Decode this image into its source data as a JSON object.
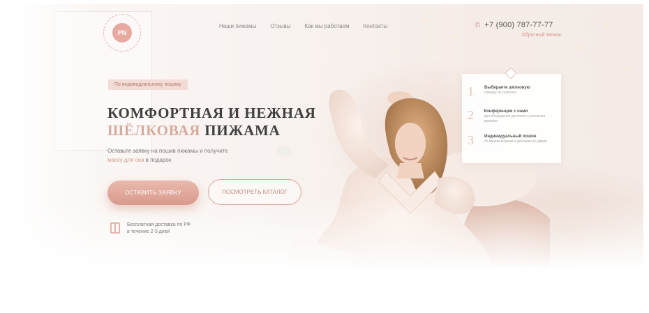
{
  "logo": {
    "mark": "PN"
  },
  "nav": {
    "items": [
      "Наши пижамы",
      "Отзывы",
      "Как мы работаем",
      "Контакты"
    ]
  },
  "header": {
    "phone": "+7 (900) 787-77-77",
    "callback_label": "Обратный звонок"
  },
  "hero": {
    "badge": "По индивидуальному пошиву",
    "headline_line1": "КОМФОРТНАЯ И НЕЖНАЯ",
    "headline_accent": "ШЁЛКОВАЯ",
    "headline_dark": "ПИЖАМА",
    "subtitle_part1": "Оставьте заявку на пошив пижамы и получите",
    "subtitle_highlight": "маску для сна",
    "subtitle_part2": "в подарок",
    "primary_button": "ОСТАВИТЬ ЗАЯВКУ",
    "secondary_button": "ПОСМОТРЕТЬ КАТАЛОГ",
    "delivery_line1": "Бесплатная доставка по РФ",
    "delivery_line2": "в течение 2-3 дней"
  },
  "steps": [
    {
      "num": "1",
      "title": "Выбираете шёлковую",
      "desc": "пижаму из каталога"
    },
    {
      "num": "2",
      "title": "Конференция с нами",
      "desc": "для обсуждения деталей и уточнения размера"
    },
    {
      "num": "3",
      "title": "Индивидуальный пошив",
      "desc": "по вашим меркам и доставка до двери"
    }
  ],
  "colors": {
    "accent": "#d89a8c",
    "accent_light": "#f3dcd5",
    "text_dark": "#3f3f3f"
  },
  "icons": {
    "phone": "phone-icon",
    "gift": "gift-icon",
    "logo": "logo-icon"
  }
}
